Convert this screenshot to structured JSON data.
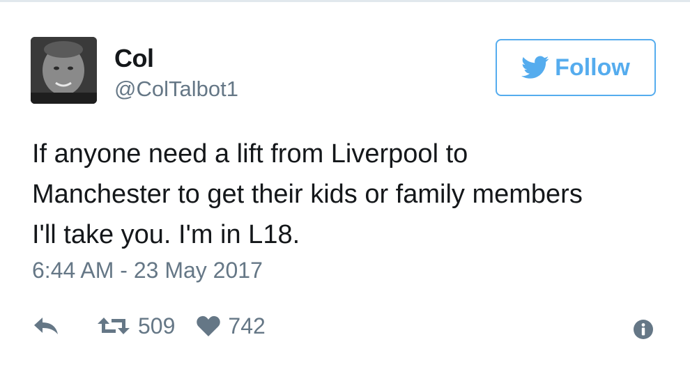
{
  "user": {
    "display_name": "Col",
    "handle": "@ColTalbot1"
  },
  "follow_button": {
    "label": "Follow",
    "icon": "twitter-bird-icon"
  },
  "tweet": {
    "text": "If anyone need a lift from Liverpool to\nManchester to get their kids or family members\nI'll take you. I'm in L18.",
    "timestamp": "6:44 AM - 23 May 2017"
  },
  "actions": {
    "reply_icon": "reply-icon",
    "retweet_icon": "retweet-icon",
    "retweet_count": "509",
    "like_icon": "heart-icon",
    "like_count": "742",
    "info_icon": "info-icon"
  },
  "colors": {
    "accent": "#55acee",
    "text": "#14171a",
    "muted": "#657786",
    "border": "#e1e8ed"
  }
}
